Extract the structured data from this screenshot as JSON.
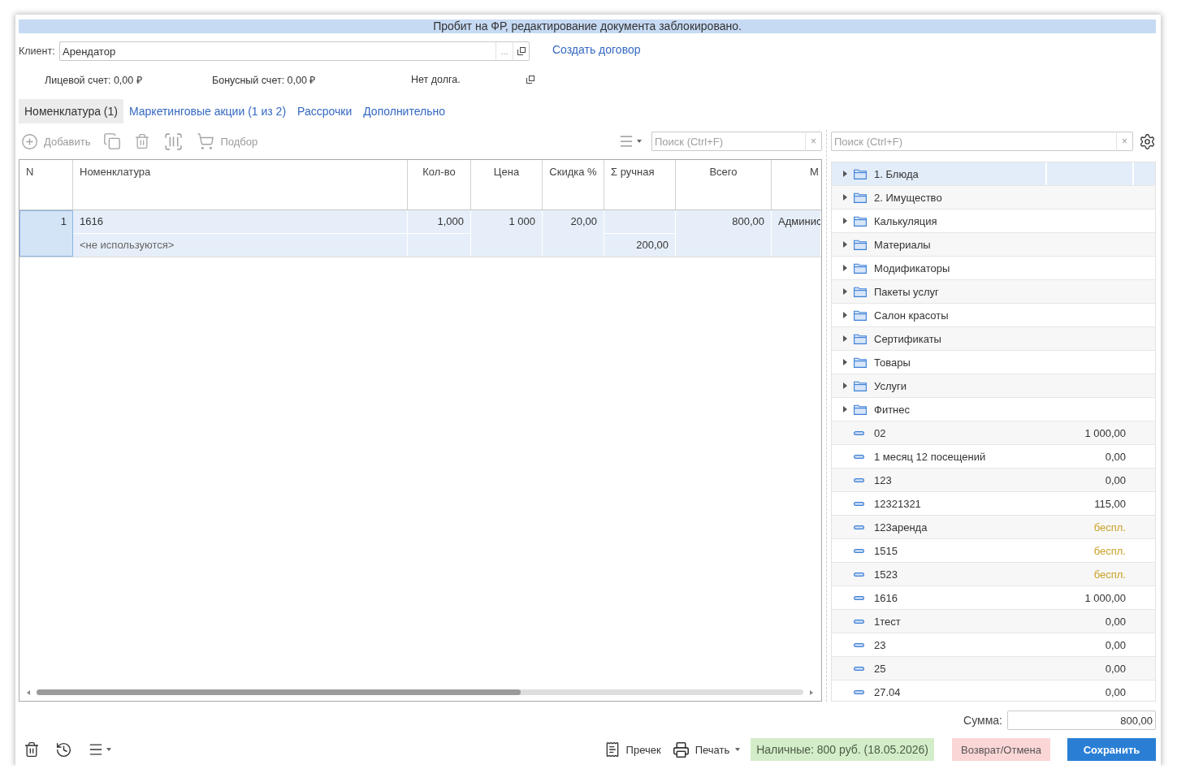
{
  "notice": "Пробит на ФР, редактирование документа заблокировано.",
  "client": {
    "label": "Клиент:",
    "value": "Арендатор",
    "select_button": "..."
  },
  "create_contract_link": "Создать договор",
  "balances": [
    "Лицевой счет: 0,00 ₽",
    "Бонусный счет: 0,00 ₽",
    "Нет долга."
  ],
  "tabs": [
    {
      "label": "Номенклатура (1)",
      "selected": true
    },
    {
      "label": "Маркетинговые акции (1 из 2)",
      "selected": false
    },
    {
      "label": "Рассрочки",
      "selected": false
    },
    {
      "label": "Дополнительно",
      "selected": false
    }
  ],
  "toolbar": [
    {
      "kind": "add",
      "label": "Добавить",
      "disabled": true
    },
    {
      "kind": "copy",
      "disabled": true
    },
    {
      "kind": "delete",
      "disabled": true
    },
    {
      "kind": "barcode",
      "disabled": true
    },
    {
      "kind": "pick",
      "label": "Подбор",
      "disabled": true
    }
  ],
  "table_search": {
    "placeholder": "Поиск (Ctrl+F)",
    "clear": "×"
  },
  "table": {
    "columns": [
      "N",
      "Номенклатура",
      "Кол-во",
      "Цена",
      "Скидка %",
      "Σ ручная",
      "Всего",
      "М"
    ],
    "rows": [
      {
        "number": "1",
        "nomenclature": "1616",
        "characteristic": "<не используются>",
        "quantity": "1,000",
        "price": "1 000",
        "discount": "20,00",
        "manual_sum": "200,00",
        "total": "800,00",
        "column_8": "Админис",
        "selected": true
      }
    ]
  },
  "catalog_search": {
    "placeholder": "Поиск (Ctrl+F)",
    "clear": "×"
  },
  "catalog": [
    {
      "kind": "group",
      "label": "1. Блюда",
      "expanded": false,
      "selected": true
    },
    {
      "kind": "group",
      "label": "2. Имущество",
      "expanded": false,
      "selected": false
    },
    {
      "kind": "group",
      "label": "Калькуляция",
      "expanded": false,
      "selected": false
    },
    {
      "kind": "group",
      "label": "Материалы",
      "expanded": false,
      "selected": false
    },
    {
      "kind": "group",
      "label": "Модификаторы",
      "expanded": false,
      "selected": false
    },
    {
      "kind": "group",
      "label": "Пакеты услуг",
      "expanded": false,
      "selected": false
    },
    {
      "kind": "group",
      "label": "Салон красоты",
      "expanded": false,
      "selected": false
    },
    {
      "kind": "group",
      "label": "Сертификаты",
      "expanded": false,
      "selected": false
    },
    {
      "kind": "group",
      "label": "Товары",
      "expanded": false,
      "selected": false
    },
    {
      "kind": "group",
      "label": "Услуги",
      "expanded": false,
      "selected": false
    },
    {
      "kind": "group",
      "label": "Фитнес",
      "expanded": false,
      "selected": false
    },
    {
      "kind": "item",
      "label": "02",
      "price": "1 000,00",
      "free": false,
      "selected": false
    },
    {
      "kind": "item",
      "label": "1 месяц 12 посещений",
      "price": "0,00",
      "free": false,
      "selected": false
    },
    {
      "kind": "item",
      "label": "123",
      "price": "0,00",
      "free": false,
      "selected": false
    },
    {
      "kind": "item",
      "label": "12321321",
      "price": "115,00",
      "free": false,
      "selected": false
    },
    {
      "kind": "item",
      "label": "123аренда",
      "price": "беспл.",
      "free": true,
      "selected": false
    },
    {
      "kind": "item",
      "label": "1515",
      "price": "беспл.",
      "free": true,
      "selected": false
    },
    {
      "kind": "item",
      "label": "1523",
      "price": "беспл.",
      "free": true,
      "selected": false
    },
    {
      "kind": "item",
      "label": "1616",
      "price": "1 000,00",
      "free": false,
      "selected": false
    },
    {
      "kind": "item",
      "label": "1тест",
      "price": "0,00",
      "free": false,
      "selected": false
    },
    {
      "kind": "item",
      "label": "23",
      "price": "0,00",
      "free": false,
      "selected": false
    },
    {
      "kind": "item",
      "label": "25",
      "price": "0,00",
      "free": false,
      "selected": false
    },
    {
      "kind": "item",
      "label": "27.04",
      "price": "0,00",
      "free": false,
      "selected": false
    }
  ],
  "total": {
    "label": "Сумма:",
    "value": "800,00"
  },
  "footer": {
    "precheck": "Пречек",
    "print": "Печать",
    "payment": "Наличные: 800 руб. (18.05.2026)",
    "refund": "Возврат/Отмена",
    "save": "Сохранить"
  }
}
